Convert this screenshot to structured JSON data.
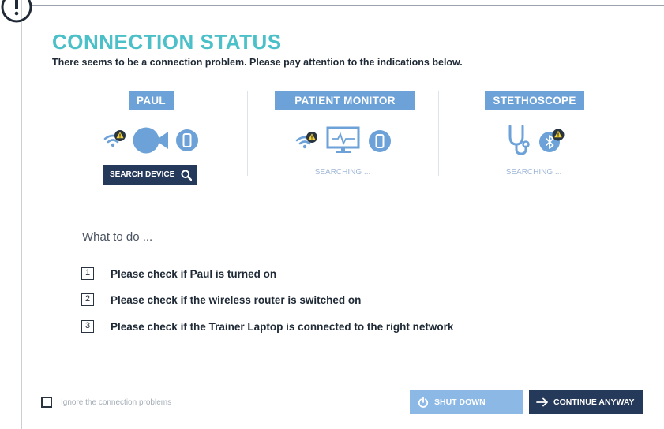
{
  "title": "CONNECTION STATUS",
  "subtitle": "There seems to be a connection problem. Please pay attention to the indications below.",
  "devices": [
    {
      "label": "PAUL",
      "icons": [
        "wifi-warning-icon",
        "camera-icon",
        "phone-icon"
      ],
      "action_label": "SEARCH DEVICE"
    },
    {
      "label": "PATIENT MONITOR",
      "icons": [
        "wifi-warning-icon",
        "monitor-icon",
        "phone-icon"
      ],
      "status": "SEARCHING ..."
    },
    {
      "label": "STETHOSCOPE",
      "icons": [
        "stethoscope-icon",
        "bluetooth-warning-icon"
      ],
      "status": "SEARCHING ..."
    }
  ],
  "what_to_do": {
    "heading": "What to do ...",
    "steps": [
      {
        "num": "1",
        "text": "Please check if Paul is turned on"
      },
      {
        "num": "2",
        "text": "Please check if the wireless router is switched on"
      },
      {
        "num": "3",
        "text": "Please check if the Trainer Laptop is connected to the right network"
      }
    ]
  },
  "footer": {
    "ignore_label": "Ignore the connection problems",
    "ignore_checked": false,
    "shutdown_label": "SHUT DOWN",
    "continue_label": "CONTINUE ANYWAY"
  },
  "colors": {
    "accent_teal": "#4cc0c8",
    "label_blue": "#6da2d8",
    "dark_navy": "#25395a",
    "light_button": "#8cb8e6",
    "warning_yellow": "#f5d130"
  }
}
